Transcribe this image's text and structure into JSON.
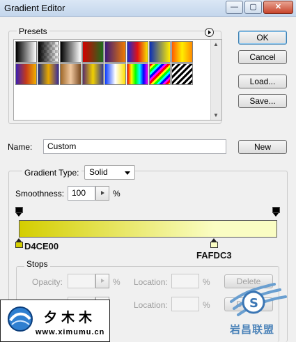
{
  "window": {
    "title": "Gradient Editor",
    "minimize_glyph": "—",
    "restore_glyph": "▢",
    "close_glyph": "✕"
  },
  "presets": {
    "label": "Presets",
    "menu_icon": "circle-arrow-right-icon",
    "scroll_up_glyph": "▲",
    "scroll_down_glyph": "▼",
    "swatches": [
      "linear-gradient(90deg,#000,#fff)",
      "linear-gradient(90deg,#000,rgba(0,0,0,0)) , repeating-conic-gradient(#c8c8c8 0% 25%, #fff 0% 50%) 0 0/8px 8px",
      "linear-gradient(90deg,#000,#fff)",
      "linear-gradient(90deg,#d40000,#1d6d1d)",
      "linear-gradient(90deg,#3d1a7a,#f07a00)",
      "linear-gradient(90deg,#1b2bd2,#e31212,#f7e600)",
      "linear-gradient(90deg,#0b2fb6,#ffec00)",
      "linear-gradient(90deg,#ff5a00,#ffee00,#ff8a00)",
      "linear-gradient(90deg,#3b1fb0,#c63b1a,#f0b000)",
      "linear-gradient(90deg,#1e2c7a,#e8a800,#3a2c9a)",
      "linear-gradient(90deg,#a06828,#f0c8a0,#7a4a20)",
      "linear-gradient(90deg,#5a2c6a,#f0d000,#3a3a8a)",
      "linear-gradient(90deg,#0a3cff,#ffffff,#ffe000)",
      "linear-gradient(90deg,#ff0000,#ffff00,#00ff00,#00ffff,#0000ff,#ff00ff)",
      "repeating-linear-gradient(135deg,#ff0000 0 3px,#ffff00 3px 6px,#00ff00 6px 9px,#00ffff 9px 12px,#0000ff 12px 15px,#ff00ff 15px 18px)",
      "repeating-linear-gradient(135deg,#000 0 3px,#fff 3px 6px)"
    ]
  },
  "buttons": {
    "ok": "OK",
    "cancel": "Cancel",
    "load": "Load...",
    "save": "Save...",
    "new": "New"
  },
  "name": {
    "label": "Name:",
    "value": "Custom"
  },
  "gradient_type": {
    "label": "Gradient Type:",
    "value": "Solid"
  },
  "smoothness": {
    "label": "Smoothness:",
    "value": "100",
    "unit": "%"
  },
  "gradient": {
    "start_color": "#D4CE00",
    "end_color": "#FAFDC3",
    "left_label": "D4CE00",
    "right_label": "FAFDC3"
  },
  "stops": {
    "label": "Stops",
    "opacity_label": "Opacity:",
    "opacity_unit": "%",
    "location_label_1": "Location:",
    "location_unit_1": "%",
    "delete_label_1": "Delete",
    "color_label_partial": "C",
    "location_label_2": "Location:",
    "location_unit_2": "%",
    "delete_label_2": "De"
  },
  "watermark": {
    "cn": "夕木木",
    "url": "www.ximumu.cn",
    "site": "岩昌联盟",
    "logo_letter": "S"
  }
}
